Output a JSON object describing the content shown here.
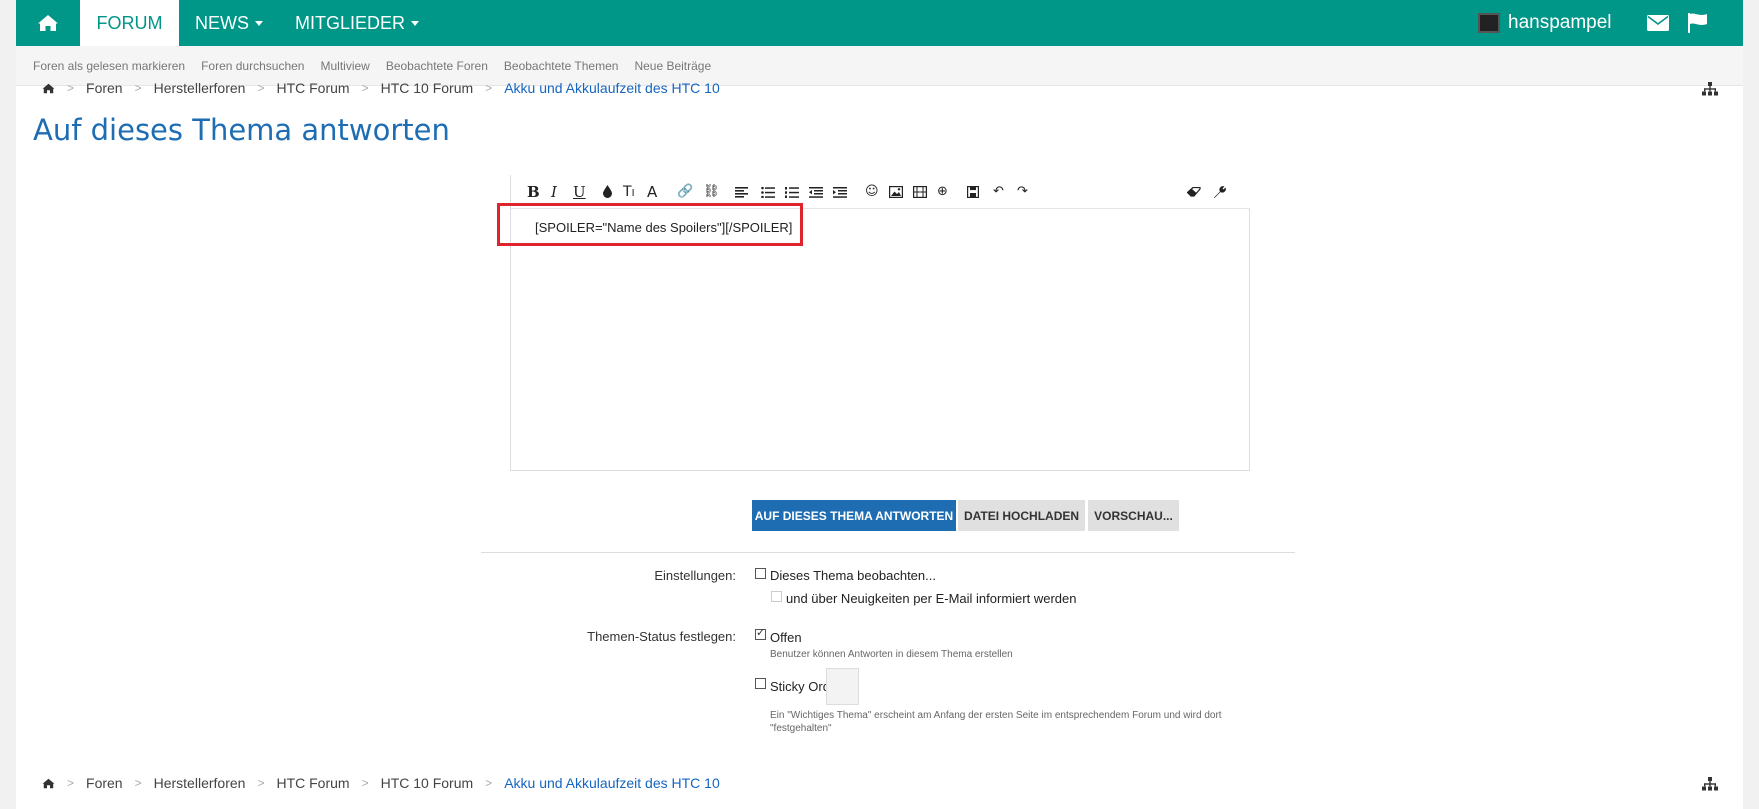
{
  "topnav": {
    "tabs": [
      {
        "label": "FORUM"
      },
      {
        "label": "NEWS"
      },
      {
        "label": "MITGLIEDER"
      }
    ],
    "username": "hanspampel",
    "brand_color": "#009688"
  },
  "subnav": {
    "links": [
      "Foren als gelesen markieren",
      "Foren durchsuchen",
      "Multiview",
      "Beobachtete Foren",
      "Beobachtete Themen",
      "Neue Beiträge"
    ]
  },
  "breadcrumb": {
    "items": [
      "Foren",
      "Herstellerforen",
      "HTC Forum",
      "HTC 10 Forum"
    ],
    "current": "Akku und Akkulaufzeit des HTC 10"
  },
  "page_title": "Auf dieses Thema antworten",
  "editor": {
    "content": "[SPOILER=\"Name des Spoilers\"][/SPOILER]"
  },
  "buttons": {
    "reply": "AUF DIESES THEMA ANTWORTEN",
    "upload": "DATEI HOCHLADEN",
    "preview": "VORSCHAU..."
  },
  "settings": {
    "label": "Einstellungen:",
    "watch": "Dieses Thema beobachten...",
    "email": "und über Neuigkeiten per E-Mail informiert werden"
  },
  "thread_status": {
    "label": "Themen-Status festlegen:",
    "open": "Offen",
    "open_hint": "Benutzer können Antworten in diesem Thema erstellen",
    "sticky": "Sticky Order",
    "sticky_hint_1": "Ein \"Wichtiges Thema\" erscheint am Anfang der ersten Seite im entsprechendem Forum und wird dort",
    "sticky_hint_2": "\"festgehalten\""
  }
}
